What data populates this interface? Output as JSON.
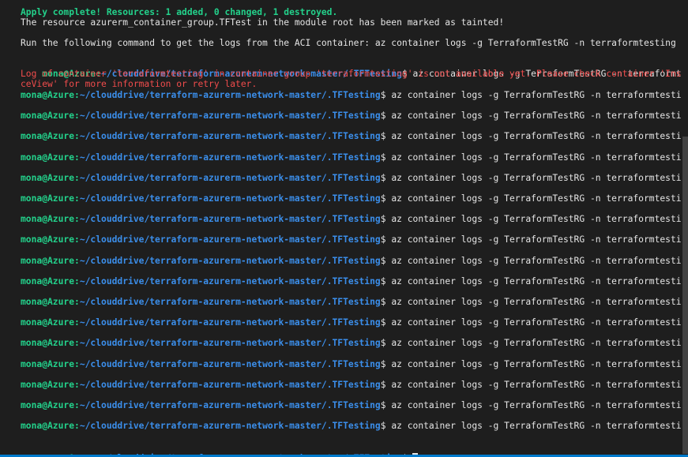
{
  "terminal": {
    "apply_complete": "Apply complete! Resources: 1 added, 0 changed, 1 destroyed.",
    "tainted_msg": "The resource azurerm_container_group.TFTest in the module root has been marked as tainted!",
    "run_msg": "Run the following command to get the logs from the ACI container: az container logs -g TerraformTestRG -n terraformtesting",
    "prompt_user": "mona@Azure",
    "prompt_sep": ":",
    "prompt_path": "~/clouddrive/terraform-azurerm-network-master/.TFTesting",
    "prompt_dollar": "$",
    "command": " az container logs -g TerraformTestRG -n terraformtesting",
    "error_line1": "Log of container 'terraformtesting' in container group 'terraformtesting' is not available yet. Please check container 'Instan",
    "error_line2": "ceView' for more information or retry later.",
    "colors": {
      "background": "#1e1e1e",
      "green": "#23d18b",
      "path": "#3b8eea",
      "error": "#f14c4c",
      "text": "#e5e5e5",
      "accent": "#007acc"
    }
  }
}
